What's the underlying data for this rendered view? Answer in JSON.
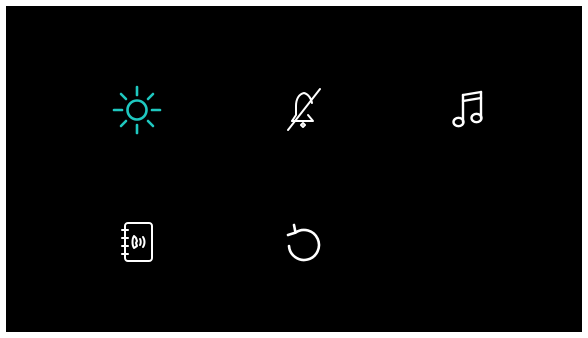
{
  "menu": {
    "items": [
      {
        "id": "brightness",
        "icon": "sun-icon",
        "selected": true
      },
      {
        "id": "mute",
        "icon": "bell-off-icon",
        "selected": false
      },
      {
        "id": "music",
        "icon": "music-note-icon",
        "selected": false
      },
      {
        "id": "contacts",
        "icon": "phonebook-icon",
        "selected": false
      },
      {
        "id": "reset",
        "icon": "reset-icon",
        "selected": false
      }
    ]
  },
  "colors": {
    "background": "#000000",
    "frame": "#ffffff",
    "icon_default": "#ffffff",
    "icon_selected": "#1fc8c0"
  }
}
